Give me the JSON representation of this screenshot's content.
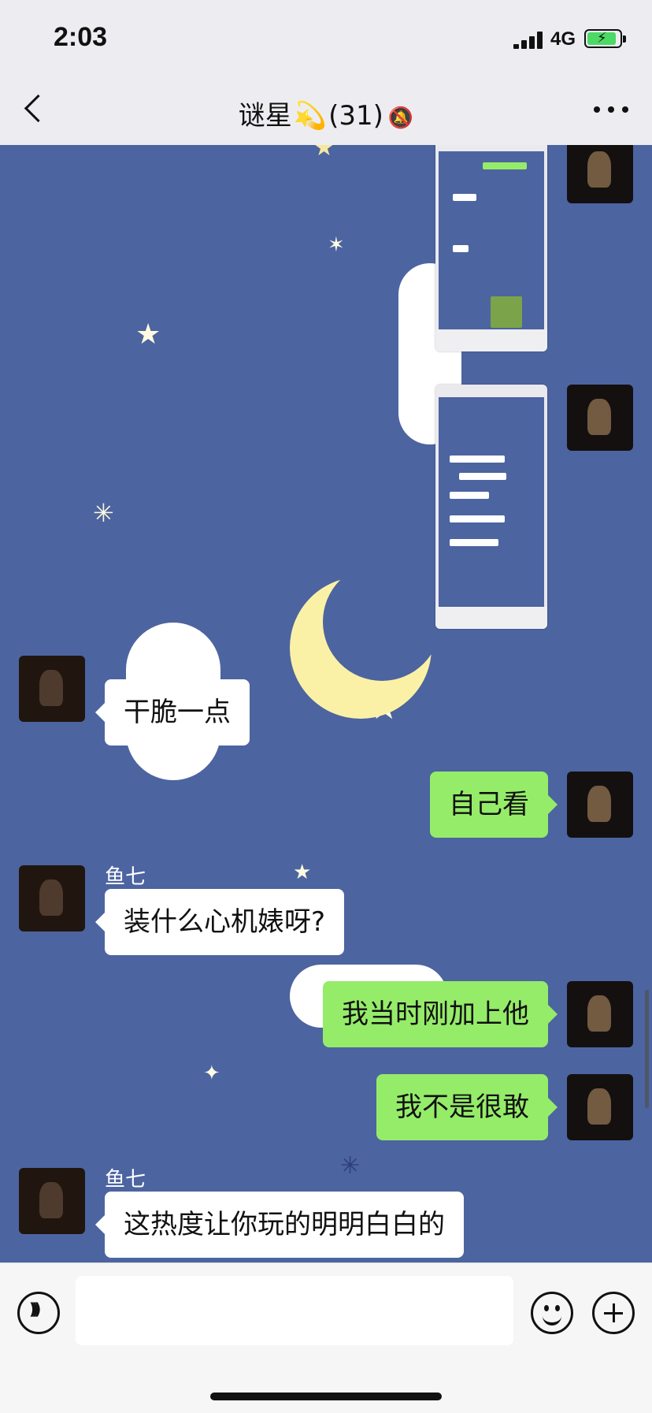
{
  "status_bar": {
    "time": "2:03",
    "network": "4G"
  },
  "nav": {
    "title_name": "谜星",
    "title_emoji": "💫",
    "member_count": "(31)",
    "mute_glyph": "🔕"
  },
  "screenshots": [
    {
      "from": "me",
      "label": "chat-screenshot-1"
    },
    {
      "from": "me",
      "label": "chat-screenshot-2"
    }
  ],
  "messages": [
    {
      "from": "other",
      "sender": "",
      "text": "干脆一点"
    },
    {
      "from": "me",
      "text": "自己看"
    },
    {
      "from": "other",
      "sender": "鱼七",
      "text": "装什么心机婊呀?"
    },
    {
      "from": "me",
      "text": "我当时刚加上他"
    },
    {
      "from": "me",
      "text": "我不是很敢"
    },
    {
      "from": "other",
      "sender": "鱼七",
      "text": "这热度让你玩的明明白白的"
    }
  ],
  "input": {
    "value": ""
  },
  "colors": {
    "chat_background": "#4c64a0",
    "my_bubble": "#95ec69",
    "their_bubble": "#ffffff",
    "moon": "#fbf1a6"
  }
}
